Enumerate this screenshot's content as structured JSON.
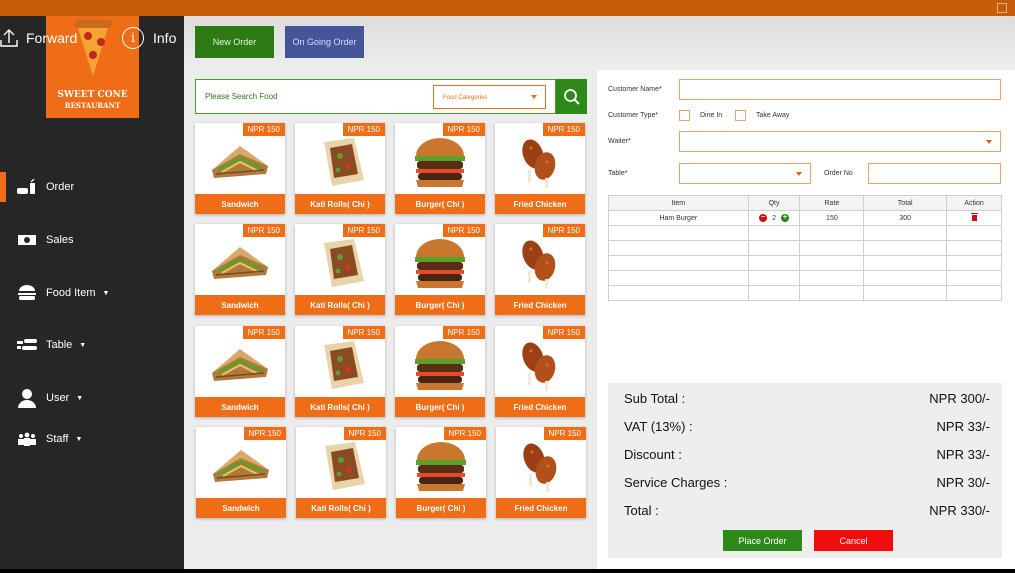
{
  "window": {
    "accent_color": "#c45c0a"
  },
  "header": {
    "forward_label": "Forward",
    "info_label": "Info"
  },
  "logo": {
    "title": "SWEET CONE",
    "subtitle": "RESTAURANT"
  },
  "sidebar": {
    "items": [
      {
        "label": "Order",
        "icon": "order-icon",
        "has_dropdown": false,
        "active": true
      },
      {
        "label": "Sales",
        "icon": "sales-icon",
        "has_dropdown": false,
        "active": false
      },
      {
        "label": "Food Item",
        "icon": "burger-icon",
        "has_dropdown": true,
        "active": false
      },
      {
        "label": "Table",
        "icon": "table-icon",
        "has_dropdown": true,
        "active": false
      },
      {
        "label": "User",
        "icon": "user-icon",
        "has_dropdown": true,
        "active": false
      },
      {
        "label": "Staff",
        "icon": "staff-icon",
        "has_dropdown": true,
        "active": false
      }
    ]
  },
  "toolbar": {
    "new_order_label": "New Order",
    "ongoing_order_label": "On Going Order"
  },
  "search": {
    "placeholder": "Please Search Food",
    "category_placeholder": "Food Categories"
  },
  "food_items": [
    {
      "name": "Sandwich",
      "price": "NPR 150",
      "kind": "sandwich"
    },
    {
      "name": "Kati Rolls( Chi )",
      "price": "NPR 150",
      "kind": "roll"
    },
    {
      "name": "Burger( Chi )",
      "price": "NPR 150",
      "kind": "burger"
    },
    {
      "name": "Fried Chicken",
      "price": "NPR 150",
      "kind": "chicken"
    }
  ],
  "order_form": {
    "customer_name_label": "Customer Name*",
    "customer_name_value": "",
    "customer_type_label": "Customer Type*",
    "dine_in_label": "Dine In",
    "take_away_label": "Take Away",
    "waiter_label": "Waiter*",
    "waiter_value": "",
    "table_label": "Table*",
    "table_value": "",
    "order_no_label": "Order No",
    "order_no_value": ""
  },
  "order_table": {
    "headers": {
      "item": "Item",
      "qty": "Qty",
      "rate": "Rate",
      "total": "Total",
      "action": "Action"
    },
    "rows": [
      {
        "item": "Ham Burger",
        "qty": "2",
        "rate": "150",
        "total": "300"
      }
    ]
  },
  "summary": {
    "sub_total_label": "Sub Total :",
    "sub_total_value": "NPR 300/-",
    "vat_label": "VAT (13%) :",
    "vat_value": "NPR 33/-",
    "discount_label": "Discount :",
    "discount_value": "NPR 33/-",
    "service_label": "Service Charges :",
    "service_value": "NPR 30/-",
    "total_label": "Total :",
    "total_value": "NPR 330/-"
  },
  "actions": {
    "place_order_label": "Place Order",
    "cancel_label": "Cancel"
  }
}
